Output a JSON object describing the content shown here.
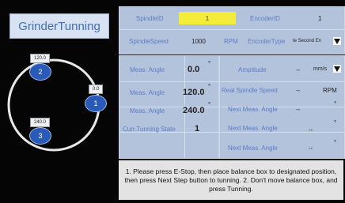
{
  "title": "GrinderTunning",
  "dial": {
    "points": [
      {
        "label": "2",
        "angle_tag": "120.0"
      },
      {
        "label": "1",
        "angle_tag": "0.0"
      },
      {
        "label": "3",
        "angle_tag": "240.0"
      }
    ]
  },
  "top": {
    "spindle_id_label": "SpindleID",
    "spindle_id_value": "1",
    "encoder_id_label": "EncoderID",
    "encoder_id_value": "1",
    "spindle_speed_label": "SpindleSpeed",
    "spindle_speed_value": "1000",
    "rpm_label": "RPM",
    "encoder_type_label": "EncoderType",
    "encoder_type_value": "te Second En"
  },
  "left": {
    "meas1_label": "Meas. Angle",
    "meas1_value": "0.0",
    "meas1_unit": "°",
    "meas2_label": "Meas. Angle",
    "meas2_value": "120.0",
    "meas2_unit": "°",
    "meas3_label": "Meas. Angle",
    "meas3_value": "240.0",
    "meas3_unit": "°",
    "state_label": "Curr.Tunning State",
    "state_value": "1"
  },
  "right": {
    "amplitude_label": "Amplitude",
    "amplitude_value": "--",
    "amplitude_unit": "mm/s",
    "real_speed_label": "Real Spindle Speed",
    "real_speed_value": "--",
    "real_speed_unit": "RPM",
    "next1_label": "Next Meas. Angle",
    "next1_value": "--",
    "next1_unit": "°",
    "next2_label": "Next Meas. Angle",
    "next2_value": "--",
    "next2_unit": "°",
    "next3_label": "Next Meas. Angle",
    "next3_value": "--",
    "next3_unit": "°"
  },
  "message": "1. Please press E-Stop, then place balance box to designated position, then press Next Step button to tunning.   2. Don't move balance box, and press Tunning.",
  "colors": {
    "accent_yellow": "#f4ec3a",
    "point_blue": "#2a5ab8",
    "panel": "#b4c3dc",
    "label_blue": "#5b7cc6"
  }
}
